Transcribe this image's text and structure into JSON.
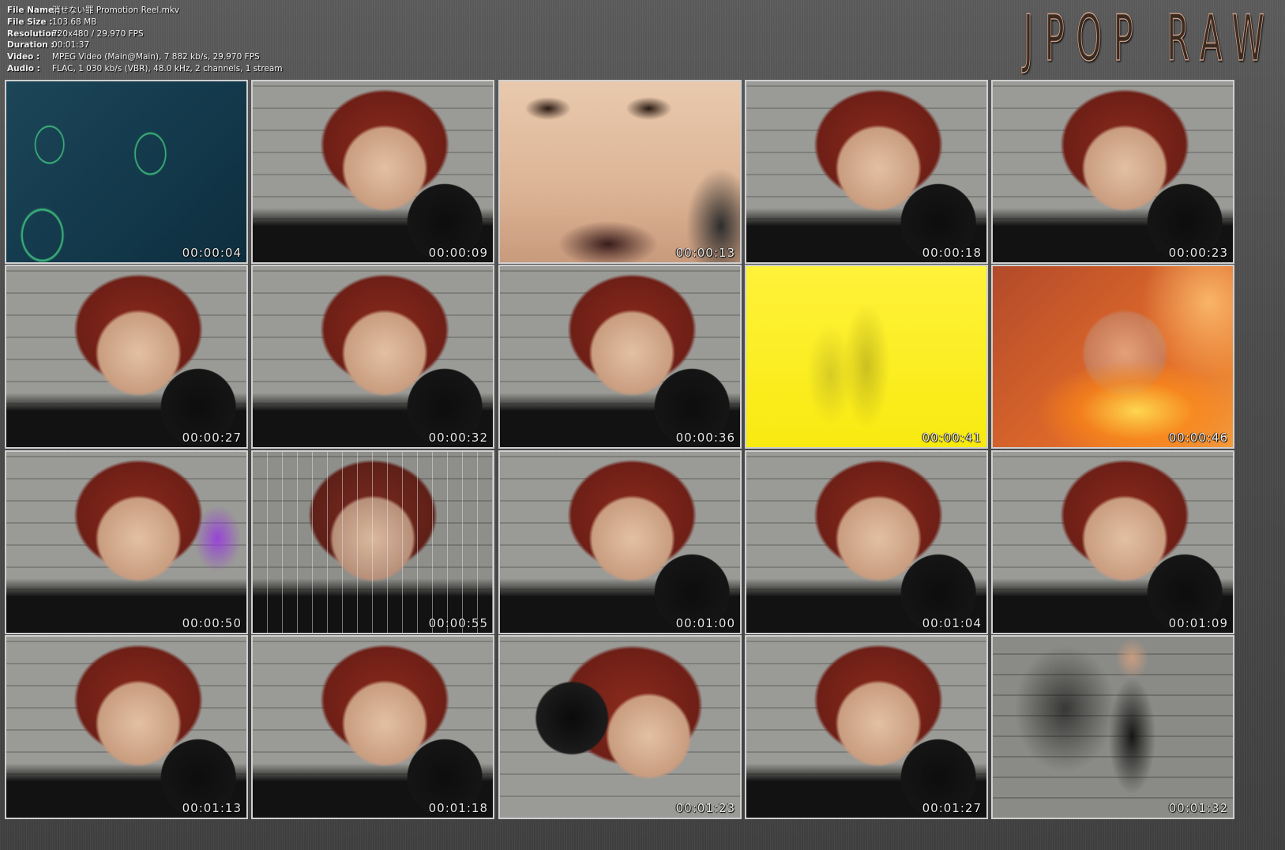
{
  "meta": {
    "rows": [
      {
        "key": "File Name :",
        "value": "消せない罪 Promotion Reel.mkv"
      },
      {
        "key": "File Size   :",
        "value": "103.68 MB"
      },
      {
        "key": "Resolution:",
        "value": "720x480 / 29.970 FPS"
      },
      {
        "key": "Duration   :",
        "value": "00:01:37"
      },
      {
        "key": "Video        :",
        "value": "MPEG Video (Main@Main), 7 882 kb/s, 29.970 FPS"
      },
      {
        "key": "Audio        :",
        "value": "FLAC, 1 030 kb/s (VBR), 48.0 kHz, 2 channels, 1 stream"
      }
    ]
  },
  "brand": "JPOP RAW",
  "thumbnails": [
    {
      "time": "00:00:04",
      "scene": "teal-writing"
    },
    {
      "time": "00:00:09",
      "scene": "studio"
    },
    {
      "time": "00:00:13",
      "scene": "closeup-face"
    },
    {
      "time": "00:00:18",
      "scene": "studio"
    },
    {
      "time": "00:00:23",
      "scene": "studio"
    },
    {
      "time": "00:00:27",
      "scene": "studio"
    },
    {
      "time": "00:00:32",
      "scene": "studio"
    },
    {
      "time": "00:00:36",
      "scene": "studio"
    },
    {
      "time": "00:00:41",
      "scene": "yellow"
    },
    {
      "time": "00:00:46",
      "scene": "orange-flare"
    },
    {
      "time": "00:00:50",
      "scene": "studio-purple"
    },
    {
      "time": "00:00:55",
      "scene": "studio-scratched"
    },
    {
      "time": "00:01:00",
      "scene": "studio"
    },
    {
      "time": "00:01:04",
      "scene": "studio"
    },
    {
      "time": "00:01:09",
      "scene": "studio"
    },
    {
      "time": "00:01:13",
      "scene": "studio"
    },
    {
      "time": "00:01:18",
      "scene": "studio"
    },
    {
      "time": "00:01:23",
      "scene": "studio-sony"
    },
    {
      "time": "00:01:27",
      "scene": "studio"
    },
    {
      "time": "00:01:32",
      "scene": "studio-wide"
    }
  ]
}
